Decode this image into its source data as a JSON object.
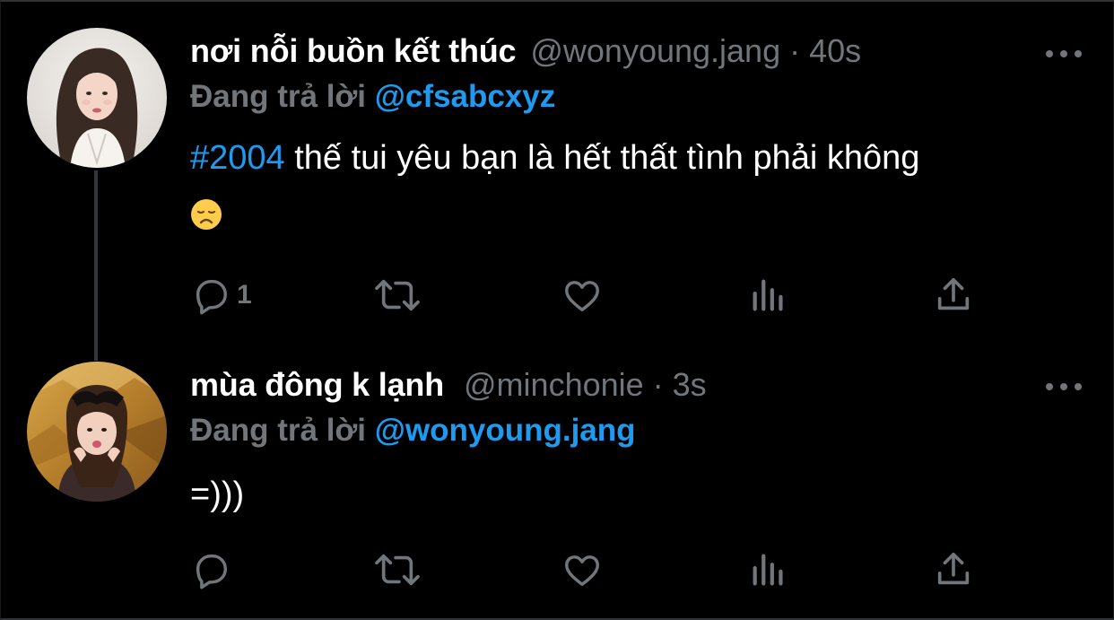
{
  "tweets": [
    {
      "display_name": "nơi nỗi buồn kết thúc",
      "handle": "@wonyoung.jang",
      "separator": "·",
      "time": "40s",
      "reply_prefix": "Đang trả lời",
      "reply_to": "@cfsabcxyz",
      "hashtag": "#2004",
      "text": " thế tui yêu bạn là hết thất tình phải không",
      "emoji": "disappointed-face-emoji",
      "reply_count": "1"
    },
    {
      "display_name": "mùa đông k lạnh",
      "handle": "@minchonie",
      "separator": "·",
      "time": "3s",
      "reply_prefix": "Đang trả lời",
      "reply_to": "@wonyoung.jang",
      "text": "=)))",
      "reply_count": ""
    }
  ],
  "icons": {
    "reply": "reply-icon",
    "retweet": "retweet-icon",
    "like": "like-icon",
    "views": "views-icon",
    "share": "share-icon",
    "more": "more-icon"
  },
  "colors": {
    "background": "#000000",
    "text_primary": "#ffffff",
    "text_secondary": "#71767b",
    "accent": "#1d9bf0",
    "thread_line": "#333639"
  }
}
